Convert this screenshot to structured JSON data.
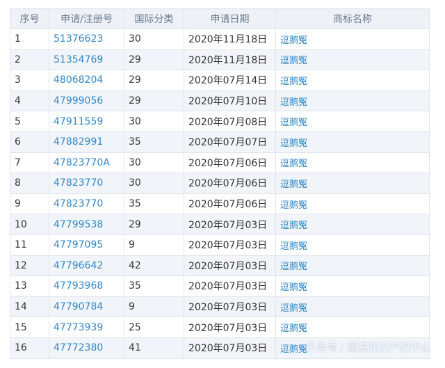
{
  "headers": [
    "序号",
    "申请/注册号",
    "国际分类",
    "申请日期",
    "商标名称"
  ],
  "rows": [
    {
      "no": "1",
      "reg": "51376623",
      "cls": "30",
      "date": "2020年11月18日",
      "name": "逗鹅冤"
    },
    {
      "no": "2",
      "reg": "51354769",
      "cls": "29",
      "date": "2020年11月18日",
      "name": "逗鹅冤"
    },
    {
      "no": "3",
      "reg": "48068204",
      "cls": "29",
      "date": "2020年07月14日",
      "name": "逗鹅冤"
    },
    {
      "no": "4",
      "reg": "47999056",
      "cls": "29",
      "date": "2020年07月10日",
      "name": "逗鹅冤"
    },
    {
      "no": "5",
      "reg": "47911559",
      "cls": "30",
      "date": "2020年07月08日",
      "name": "逗鹅冤"
    },
    {
      "no": "6",
      "reg": "47882991",
      "cls": "35",
      "date": "2020年07月07日",
      "name": "逗鹅冤"
    },
    {
      "no": "7",
      "reg": "47823770A",
      "cls": "30",
      "date": "2020年07月06日",
      "name": "逗鹅冤"
    },
    {
      "no": "8",
      "reg": "47823770",
      "cls": "30",
      "date": "2020年07月06日",
      "name": "逗鹅冤"
    },
    {
      "no": "9",
      "reg": "47823770",
      "cls": "35",
      "date": "2020年07月06日",
      "name": "逗鹅冤"
    },
    {
      "no": "10",
      "reg": "47799538",
      "cls": "29",
      "date": "2020年07月03日",
      "name": "逗鹅冤"
    },
    {
      "no": "11",
      "reg": "47797095",
      "cls": "9",
      "date": "2020年07月03日",
      "name": "逗鹅冤"
    },
    {
      "no": "12",
      "reg": "47796642",
      "cls": "42",
      "date": "2020年07月03日",
      "name": "逗鹅冤"
    },
    {
      "no": "13",
      "reg": "47793968",
      "cls": "35",
      "date": "2020年07月03日",
      "name": "逗鹅冤"
    },
    {
      "no": "14",
      "reg": "47790784",
      "cls": "9",
      "date": "2020年07月03日",
      "name": "逗鹅冤"
    },
    {
      "no": "15",
      "reg": "47773939",
      "cls": "25",
      "date": "2020年07月03日",
      "name": "逗鹅冤"
    },
    {
      "no": "16",
      "reg": "47772380",
      "cls": "41",
      "date": "2020年07月03日",
      "name": "逗鹅冤"
    }
  ],
  "watermark": "头条号 / 国高知识产权中心",
  "colors": {
    "link": "#2f86c6",
    "header_bg": "#eef2f7",
    "row_alt_bg": "#f1f5fa",
    "border": "#dfe4ea"
  }
}
